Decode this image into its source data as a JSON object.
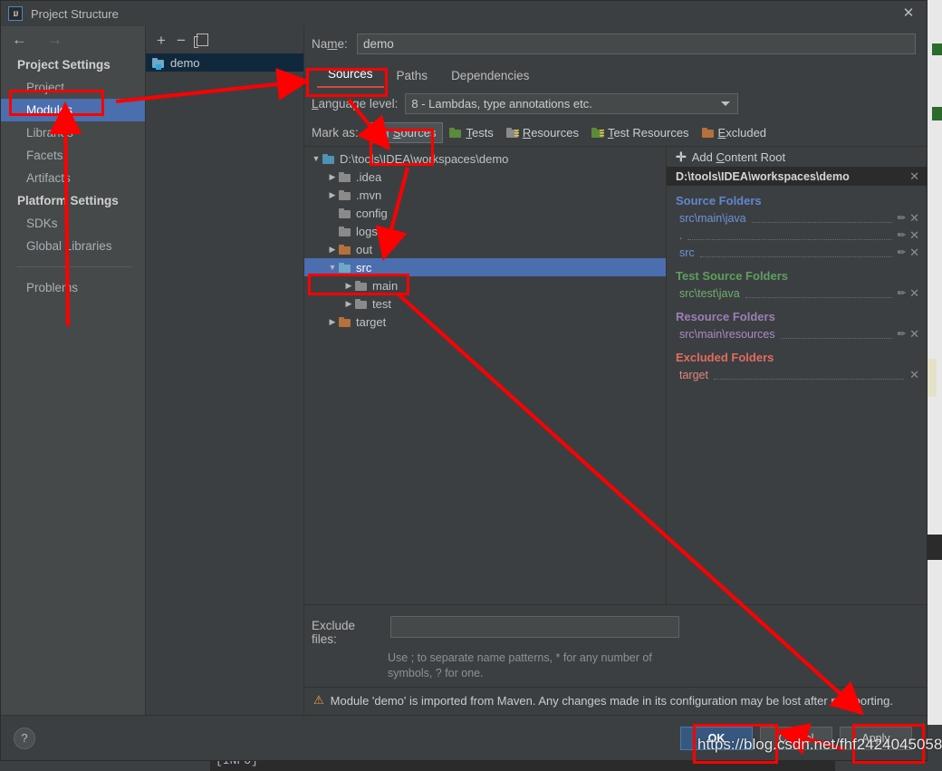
{
  "window": {
    "title": "Project Structure",
    "logo_icon": "intellij-idea-logo",
    "close_icon": "close-icon"
  },
  "sidebar": {
    "back_icon": "arrow-left-icon",
    "forward_icon": "arrow-right-icon",
    "groups": [
      {
        "label": "Project Settings",
        "items": [
          {
            "label": "Project",
            "selected": false
          },
          {
            "label": "Modules",
            "selected": true
          },
          {
            "label": "Libraries",
            "selected": false
          },
          {
            "label": "Facets",
            "selected": false
          },
          {
            "label": "Artifacts",
            "selected": false
          }
        ]
      },
      {
        "label": "Platform Settings",
        "items": [
          {
            "label": "SDKs",
            "selected": false
          },
          {
            "label": "Global Libraries",
            "selected": false
          }
        ]
      }
    ],
    "problems_label": "Problems"
  },
  "module_list": {
    "toolbar": {
      "add_icon": "plus-icon",
      "remove_icon": "minus-icon",
      "copy_icon": "copy-icon"
    },
    "modules": [
      {
        "label": "demo",
        "icon": "module-folder-icon",
        "selected": true
      }
    ]
  },
  "main": {
    "name_label": "Name:",
    "name_value": "demo",
    "tabs": [
      {
        "label": "Sources",
        "active": true
      },
      {
        "label": "Paths",
        "active": false
      },
      {
        "label": "Dependencies",
        "active": false
      }
    ],
    "language_level_label": "Language level:",
    "language_level_value": "8 - Lambdas, type annotations etc.",
    "language_level_caret_icon": "chevron-down-icon",
    "mark_as_label": "Mark as:",
    "mark_as_buttons": [
      {
        "label": "Sources",
        "icon": "blue-folder-icon",
        "selected": true
      },
      {
        "label": "Tests",
        "icon": "green-folder-icon",
        "selected": false
      },
      {
        "label": "Resources",
        "icon": "grey-resource-folder-icon",
        "selected": false
      },
      {
        "label": "Test Resources",
        "icon": "green-resource-folder-icon",
        "selected": false
      },
      {
        "label": "Excluded",
        "icon": "orange-folder-icon",
        "selected": false
      }
    ],
    "tree": [
      {
        "label": "D:\\tools\\IDEA\\workspaces\\demo",
        "depth": 0,
        "arrow": "expanded",
        "icon": "teal-folder-icon",
        "selected": false
      },
      {
        "label": ".idea",
        "depth": 1,
        "arrow": "collapsed",
        "icon": "grey-folder-icon",
        "selected": false
      },
      {
        "label": ".mvn",
        "depth": 1,
        "arrow": "collapsed",
        "icon": "grey-folder-icon",
        "selected": false
      },
      {
        "label": "config",
        "depth": 1,
        "arrow": "none",
        "icon": "grey-folder-icon",
        "selected": false
      },
      {
        "label": "logs",
        "depth": 1,
        "arrow": "none",
        "icon": "grey-folder-icon",
        "selected": false
      },
      {
        "label": "out",
        "depth": 1,
        "arrow": "collapsed",
        "icon": "orange-folder-icon",
        "selected": false
      },
      {
        "label": "src",
        "depth": 1,
        "arrow": "expanded",
        "icon": "blue-folder-icon",
        "selected": true
      },
      {
        "label": "main",
        "depth": 2,
        "arrow": "collapsed",
        "icon": "grey-folder-icon",
        "selected": false
      },
      {
        "label": "test",
        "depth": 2,
        "arrow": "collapsed",
        "icon": "grey-folder-icon",
        "selected": false
      },
      {
        "label": "target",
        "depth": 1,
        "arrow": "collapsed",
        "icon": "orange-folder-icon",
        "selected": false
      }
    ],
    "exclude_files_label": "Exclude files:",
    "exclude_files_value": "",
    "exclude_files_hint": "Use ; to separate name patterns, * for any number of symbols, ? for one.",
    "warning_icon": "warning-triangle-icon",
    "warning_text": "Module 'demo' is imported from Maven. Any changes made in its configuration may be lost after reimporting."
  },
  "content_roots": {
    "add_root_label": "Add Content Root",
    "add_root_icon": "plus-icon",
    "root_path": "D:\\tools\\IDEA\\workspaces\\demo",
    "root_remove_icon": "close-icon",
    "sections": [
      {
        "title": "Source Folders",
        "kind": "src",
        "entries": [
          {
            "path": "src\\main\\java",
            "edit_icon": "pencil-icon",
            "remove_icon": "close-icon"
          },
          {
            "path": ".",
            "edit_icon": "pencil-icon",
            "remove_icon": "close-icon"
          },
          {
            "path": "src",
            "edit_icon": "pencil-icon",
            "remove_icon": "close-icon"
          }
        ]
      },
      {
        "title": "Test Source Folders",
        "kind": "test",
        "entries": [
          {
            "path": "src\\test\\java",
            "edit_icon": "pencil-icon",
            "remove_icon": "close-icon"
          }
        ]
      },
      {
        "title": "Resource Folders",
        "kind": "res",
        "entries": [
          {
            "path": "src\\main\\resources",
            "edit_icon": "pencil-icon",
            "remove_icon": "close-icon"
          }
        ]
      },
      {
        "title": "Excluded Folders",
        "kind": "exc",
        "entries": [
          {
            "path": "target",
            "edit_icon": "",
            "remove_icon": "close-icon"
          }
        ]
      }
    ]
  },
  "footer": {
    "help_label": "?",
    "help_icon": "question-mark-icon",
    "ok_label": "OK",
    "cancel_label": "Cancel",
    "apply_label": "Apply"
  },
  "background": {
    "console_text": "[INFO]"
  },
  "annotation": {
    "color": "#fe0000",
    "watermark": "https://blog.csdn.net/fhf2424045058"
  }
}
